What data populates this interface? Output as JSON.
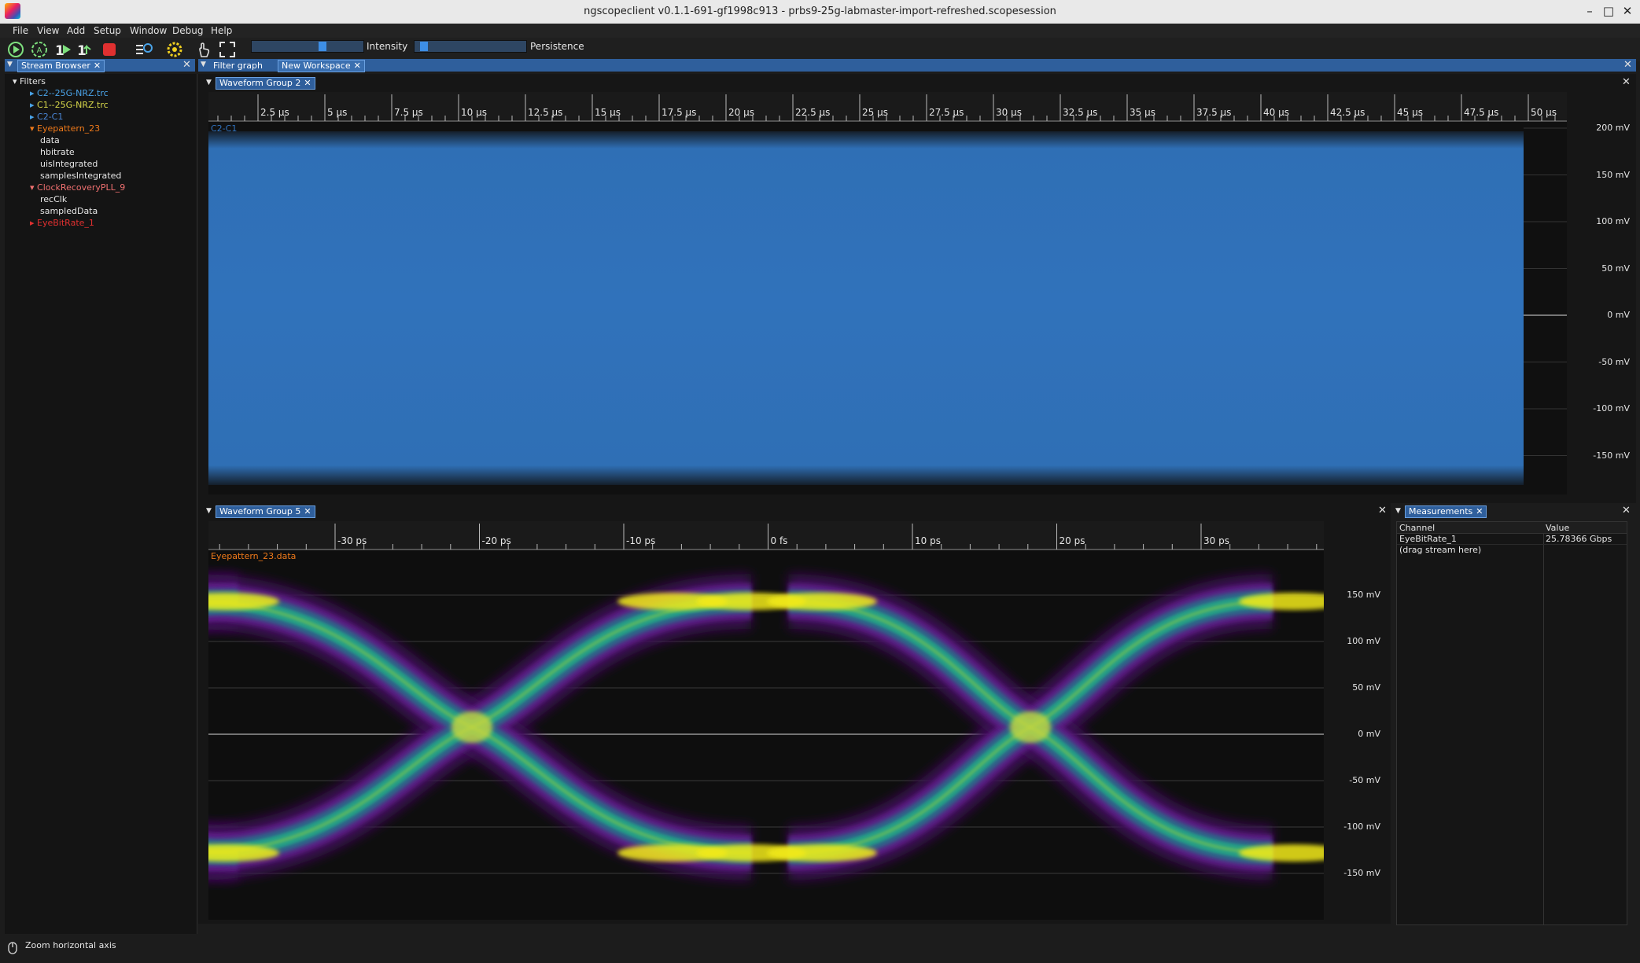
{
  "window": {
    "title": "ngscopeclient v0.1.1-691-gf1998c913 - prbs9-25g-labmaster-import-refreshed.scopesession"
  },
  "menu": [
    "File",
    "View",
    "Add",
    "Setup",
    "Window",
    "Debug",
    "Help"
  ],
  "toolbar": {
    "intensity_label": "Intensity",
    "intensity_level": 0.65,
    "persistence_label": "Persistence",
    "persistence_level": 0.05,
    "icons": [
      "run-icon",
      "auto-trigger-icon",
      "single-trigger-icon",
      "force-trigger-icon",
      "stop-icon",
      "history-icon",
      "gear-icon",
      "touch-icon",
      "fullscreen-icon"
    ]
  },
  "stream_browser": {
    "tab": "Stream Browser",
    "root": "Filters",
    "items": [
      {
        "label": "C2--25G-NRZ.trc",
        "color": "#4aa3e8",
        "expanded": false
      },
      {
        "label": "C1--25G-NRZ.trc",
        "color": "#d6d64a",
        "expanded": false
      },
      {
        "label": "C2-C1",
        "color": "#4a86d6",
        "expanded": false
      },
      {
        "label": "Eyepattern_23",
        "color": "#f07a1a",
        "expanded": true,
        "children": [
          "data",
          "hbitrate",
          "uisIntegrated",
          "samplesIntegrated"
        ]
      },
      {
        "label": "ClockRecoveryPLL_9",
        "color": "#f07070",
        "expanded": true,
        "children": [
          "recClk",
          "sampledData"
        ]
      },
      {
        "label": "EyeBitRate_1",
        "color": "#e03030",
        "expanded": false
      }
    ]
  },
  "workspace": {
    "tabs": [
      "Filter graph",
      "New Workspace"
    ]
  },
  "group2": {
    "tab": "Waveform Group 2",
    "channel_label": "C2-C1",
    "channel_color": "#2f72bf",
    "time_ticks": [
      "2.5 µs",
      "5 µs",
      "7.5 µs",
      "10 µs",
      "12.5 µs",
      "15 µs",
      "17.5 µs",
      "20 µs",
      "22.5 µs",
      "25 µs",
      "27.5 µs",
      "30 µs",
      "32.5 µs",
      "35 µs",
      "37.5 µs",
      "40 µs",
      "42.5 µs",
      "45 µs",
      "47.5 µs",
      "50 µs"
    ],
    "volt_ticks": [
      "200 mV",
      "150 mV",
      "100 mV",
      "50 mV",
      "0 mV",
      "-50 mV",
      "-100 mV",
      "-150 mV"
    ]
  },
  "group5": {
    "tab": "Waveform Group 5",
    "channel_label": "Eyepattern_23.data",
    "channel_color": "#f07a1a",
    "time_ticks": [
      "-30 ps",
      "-20 ps",
      "-10 ps",
      "0 fs",
      "10 ps",
      "20 ps",
      "30 ps"
    ],
    "volt_ticks": [
      "150 mV",
      "100 mV",
      "50 mV",
      "0 mV",
      "-50 mV",
      "-100 mV",
      "-150 mV"
    ]
  },
  "measurements": {
    "tab": "Measurements",
    "columns": [
      "Channel",
      "Value"
    ],
    "rows": [
      {
        "channel": "EyeBitRate_1",
        "value": "25.78366 Gbps"
      },
      {
        "channel": "(drag stream here)",
        "value": ""
      }
    ]
  },
  "status_bar": {
    "text": "Zoom horizontal axis"
  }
}
